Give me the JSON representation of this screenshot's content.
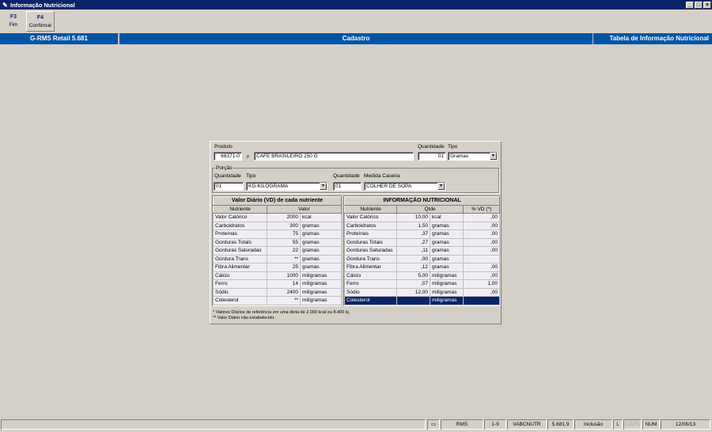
{
  "window": {
    "title": "Informação Nutricional",
    "buttons": [
      "_",
      "□",
      "×"
    ]
  },
  "toolbar": {
    "f3": {
      "key": "F3",
      "label": "Fim"
    },
    "f4": {
      "key": "F4",
      "label": "Confirmar"
    }
  },
  "header": {
    "app": "G-RMS Retail 5.681",
    "section": "Cadastro",
    "screen": "Tabela de Informação Nutricional"
  },
  "produto": {
    "label": "Produto",
    "code": "68371-0",
    "description": "CAFE BRASILEIRO 250 G",
    "quantidade_label": "Quantidade",
    "quantidade": "01",
    "tipo_label": "Tipo",
    "tipo": "Gramas"
  },
  "porcao": {
    "title": "Porção",
    "quantidade_label": "Quantidade",
    "quantidade": "01",
    "tipo_label": "Tipo",
    "tipo": "KG-KILOGRAMA",
    "quantidade2_label": "Quantidade",
    "quantidade2": "01",
    "medida_label": "Medida Caseira",
    "medida": "COLHER DE SOPA"
  },
  "vd_table": {
    "title": "Valor Diário (VD) de cada nutriente",
    "columns": [
      "Nutriente",
      "Valor"
    ],
    "rows": [
      [
        "Valor Calórico",
        "2000",
        "kcal"
      ],
      [
        "Carboidratos",
        "300",
        "gramas"
      ],
      [
        "Proteínas",
        "75",
        "gramas"
      ],
      [
        "Gorduras Totais",
        "55",
        "gramas"
      ],
      [
        "Gorduras Saturadas",
        "22",
        "gramas"
      ],
      [
        "Gordura Trans",
        "**",
        "gramas"
      ],
      [
        "Fibra Alimentar",
        "25",
        "gramas"
      ],
      [
        "Cálcio",
        "1000",
        "miligramas"
      ],
      [
        "Ferro",
        "14",
        "miligramas"
      ],
      [
        "Sódio",
        "2400",
        "miligramas"
      ],
      [
        "Colesterol",
        "**",
        "miligramas"
      ]
    ]
  },
  "info_table": {
    "title": "INFORMAÇÃO NUTRICIONAL",
    "columns": [
      "Nutriente",
      "Qtde",
      "% VD (*)"
    ],
    "rows": [
      [
        "Valor Calórico",
        "10,00",
        "kcal",
        ",00"
      ],
      [
        "Carboidratos",
        "1,50",
        "gramas",
        ",00"
      ],
      [
        "Proteínas",
        ",37",
        "gramas",
        ",00"
      ],
      [
        "Gorduras Totais",
        ",27",
        "gramas",
        ",00"
      ],
      [
        "Gorduras Saturadas",
        ",11",
        "gramas",
        ",00"
      ],
      [
        "Gordura Trans",
        ",00",
        "gramas",
        ""
      ],
      [
        "Fibra Alimentar",
        ",12",
        "gramas",
        ",00"
      ],
      [
        "Cálcio",
        "5,00",
        "miligramas",
        ",00"
      ],
      [
        "Ferro",
        ",07",
        "miligramas",
        "1,00"
      ],
      [
        "Sódio",
        "12,00",
        "miligramas",
        ",00"
      ],
      [
        "Colesterol",
        "",
        "miligramas",
        ""
      ]
    ],
    "selected_row": 10
  },
  "notes": {
    "n1": "* Valores Diários de referência em uma dieta de 2.000 kcal ou 8.400 kj.",
    "n2": "** Valor Diário não estabelecido."
  },
  "status": {
    "system": "RMS",
    "page": "1-9",
    "program": "VABCNUTR",
    "version": "5.681.9",
    "mode": "Inclusão",
    "l": "L",
    "caps": "CAPS",
    "num": "NUM",
    "date": "12/06/13"
  }
}
